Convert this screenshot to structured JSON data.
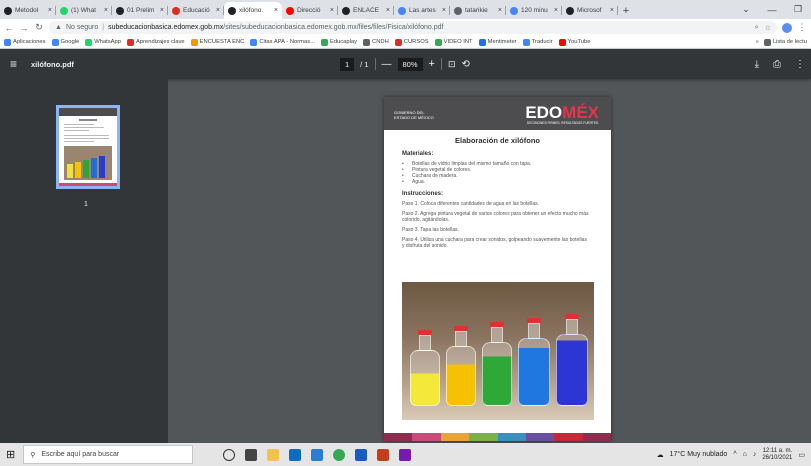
{
  "tabs": [
    {
      "label": "Metodol",
      "color": "#202124"
    },
    {
      "label": "(1) What",
      "color": "#25d366"
    },
    {
      "label": "01 Prelim",
      "color": "#202124"
    },
    {
      "label": "Educació",
      "color": "#d93025"
    },
    {
      "label": "xilófono.",
      "color": "#202124",
      "active": true
    },
    {
      "label": "Direcció",
      "color": "#ff0000"
    },
    {
      "label": "ENLACE",
      "color": "#202124"
    },
    {
      "label": "Las artes",
      "color": "#4285f4"
    },
    {
      "label": "tatarikie",
      "color": "#5f6368"
    },
    {
      "label": "120 minu",
      "color": "#4285f4"
    },
    {
      "label": "Microsof",
      "color": "#202124"
    }
  ],
  "address": {
    "security": "No seguro",
    "domain": "subeducacionbasica.edomex.gob.mx",
    "path": "/sites/subeducacionbasica.edomex.gob.mx/files/files/Fisica/xilófono.pdf"
  },
  "bookmarks": [
    {
      "label": "Aplicaciones",
      "color": "#4285f4"
    },
    {
      "label": "Google",
      "color": "#4285f4"
    },
    {
      "label": "WhatsApp",
      "color": "#25d366"
    },
    {
      "label": "Aprendizajes clave",
      "color": "#d93025"
    },
    {
      "label": "ENCUESTA ENC",
      "color": "#f29900"
    },
    {
      "label": "Citas APA - Normas...",
      "color": "#4285f4"
    },
    {
      "label": "Educaplay",
      "color": "#34a853"
    },
    {
      "label": "CNDH",
      "color": "#5f6368"
    },
    {
      "label": "CURSOS",
      "color": "#d93025"
    },
    {
      "label": "VIDEO INT",
      "color": "#34a853"
    },
    {
      "label": "Mentimeter",
      "color": "#1a73e8"
    },
    {
      "label": "Traducir",
      "color": "#4285f4"
    },
    {
      "label": "YouTube",
      "color": "#ff0000"
    }
  ],
  "bookmarks_right": "Lista de lectu",
  "pdf": {
    "filename": "xilófono.pdf",
    "page_current": "1",
    "page_total": "/ 1",
    "zoom": "80%",
    "thumb_number": "1"
  },
  "doc": {
    "gov_line1": "GOBIERNO DEL",
    "gov_line2": "ESTADO DE MÉXICO",
    "logo_a": "EDO",
    "logo_b": "MÉX",
    "slogan": "DECISIONES FIRMES, RESULTADOS FUERTES.",
    "title": "Elaboración de xilófono",
    "materials_heading": "Materiales:",
    "materials": [
      "Botellas de vidrio limpias del mismo tamaño con tapa.",
      "Pintura vegetal de colores.",
      "Cuchara de madera.",
      "Agua."
    ],
    "instructions_heading": "Instrucciones:",
    "steps": [
      "Paso 1. Coloca diferentes cantidades de agua en las botellas.",
      "Paso 2. Agrega pintura vegetal de varios colores para obtener un efecto mucho más colorido, agitándolas.",
      "Paso 3. Tapa las botellas.",
      "Paso 4. Utiliza una cuchara para crear sonidos, golpeando suavemente las botellas y disfruta del sonido."
    ],
    "footer_colors": [
      "#8c2e4e",
      "#c94b7a",
      "#e8a23a",
      "#7bb04a",
      "#3a8fbf",
      "#6b4fa0",
      "#c22a3a",
      "#8c2e4e"
    ]
  },
  "taskbar": {
    "search_placeholder": "Escribe aquí para buscar",
    "weather": "17°C  Muy nublado",
    "time": "12:11 a. m.",
    "date": "26/10/2021"
  }
}
